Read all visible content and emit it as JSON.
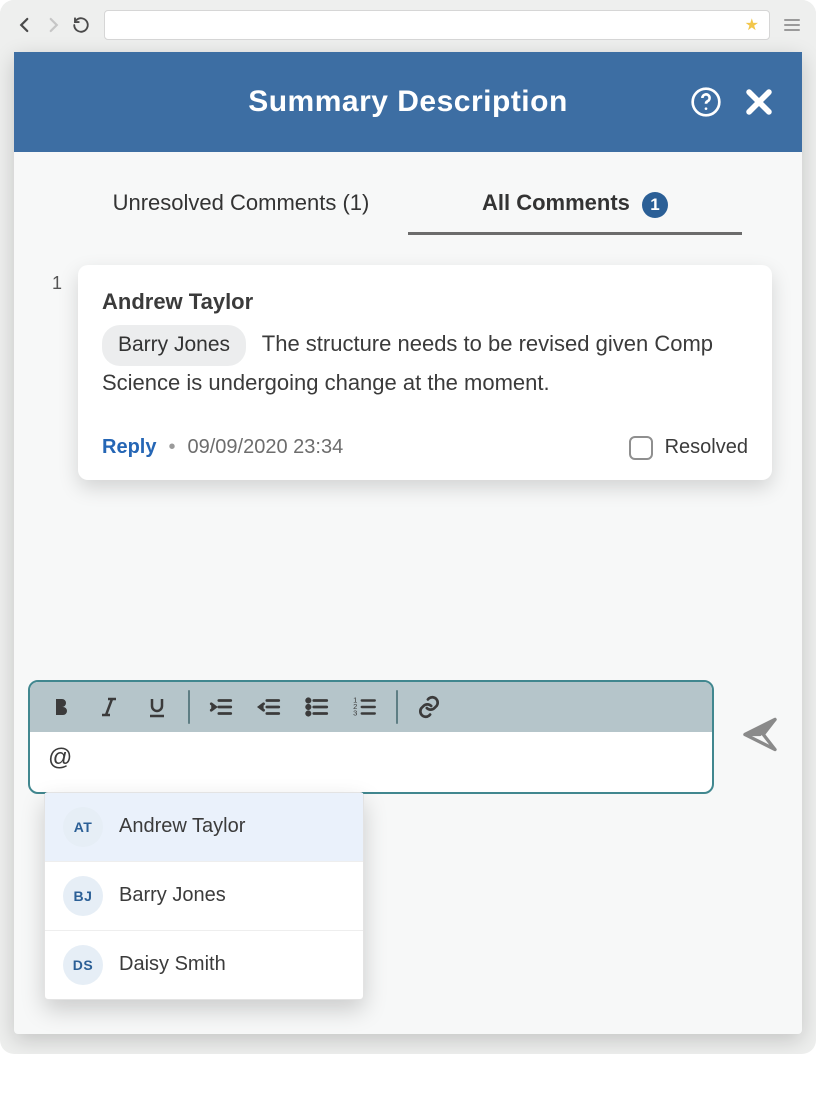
{
  "header": {
    "title": "Summary Description"
  },
  "tabs": {
    "unresolved_label": "Unresolved Comments",
    "unresolved_count": "(1)",
    "all_label": "All Comments",
    "all_count": "1"
  },
  "comment": {
    "index": "1",
    "author": "Andrew Taylor",
    "mention": "Barry Jones",
    "body_after": "The structure needs to be revised given Comp Science is undergoing change at the moment.",
    "reply_label": "Reply",
    "timestamp": "09/09/2020 23:34",
    "resolved_label": "Resolved"
  },
  "compose": {
    "input_value": "@"
  },
  "mentions": [
    {
      "initials": "AT",
      "name": "Andrew Taylor"
    },
    {
      "initials": "BJ",
      "name": "Barry Jones"
    },
    {
      "initials": "DS",
      "name": "Daisy Smith"
    }
  ]
}
